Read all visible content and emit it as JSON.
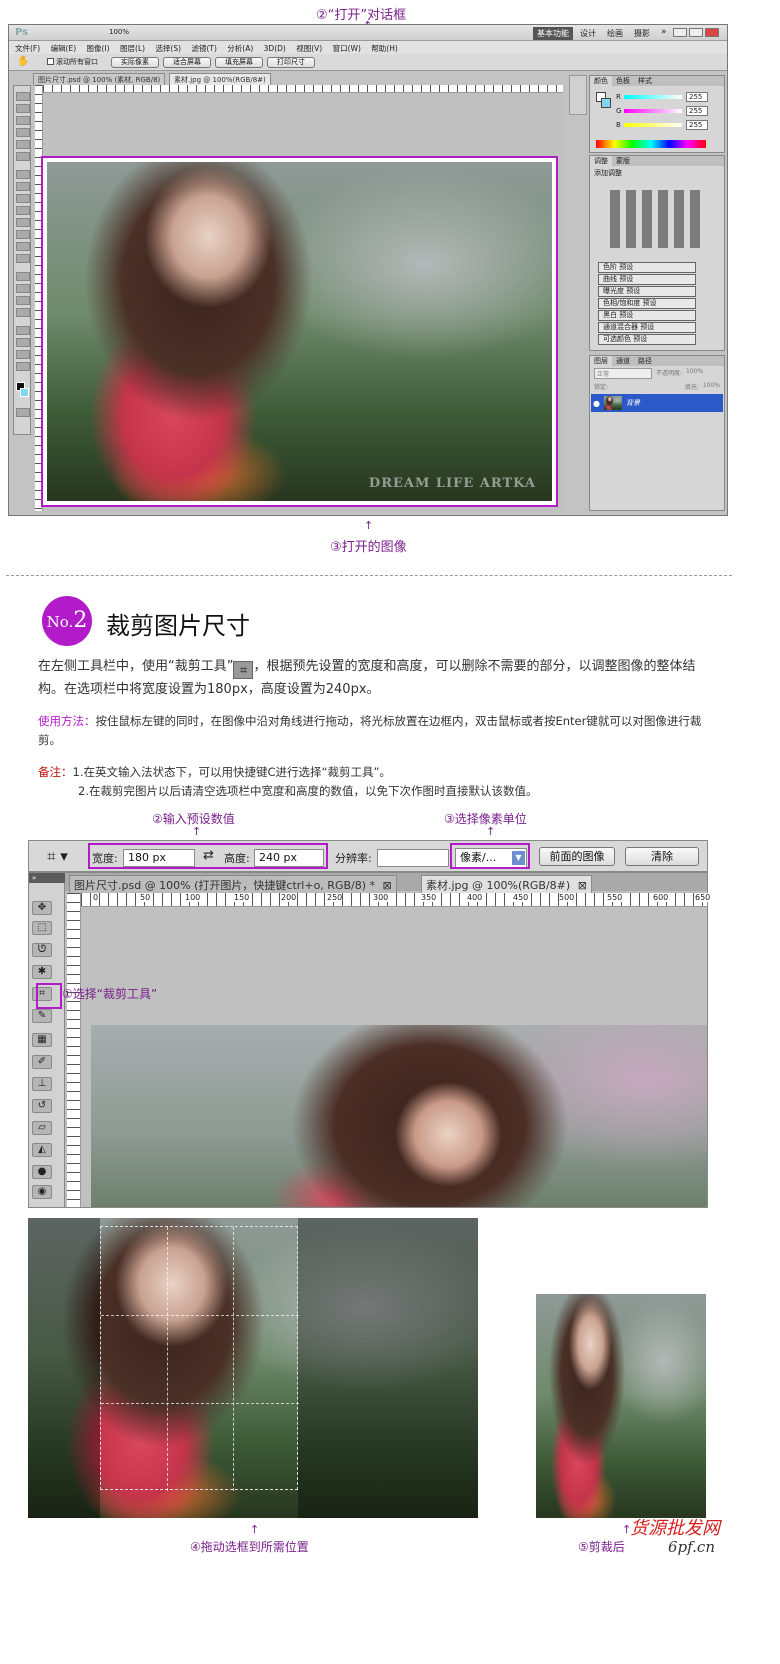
{
  "captions": {
    "open_dialog": "②“打开”对话框",
    "opened_image": "③打开的图像",
    "input_values": "②输入预设数值",
    "select_unit": "③选择像素单位",
    "select_crop_tool": "①选择“裁剪工具”",
    "drag_box": "④拖动选框到所需位置",
    "after_crop": "⑤剪裁后"
  },
  "ps_top": {
    "logo": "Ps",
    "zoom": "100%",
    "workspace_buttons": [
      "基本功能",
      "设计",
      "绘画",
      "摄影"
    ],
    "more": "»",
    "menu": [
      "文件(F)",
      "编辑(E)",
      "图像(I)",
      "图层(L)",
      "选择(S)",
      "滤镜(T)",
      "分析(A)",
      "3D(D)",
      "视图(V)",
      "窗口(W)",
      "帮助(H)"
    ],
    "options": {
      "scroll_all": "滚动所有窗口",
      "buttons": [
        "实际像素",
        "适合屏幕",
        "填充屏幕",
        "打印尺寸"
      ]
    },
    "tabs": [
      "图片尺寸.psd @ 100% (素材, RGB/8)",
      "素材.jpg @ 100%(RGB/8#)"
    ],
    "color_panel": {
      "tabs": [
        "颜色",
        "色板",
        "样式"
      ],
      "channels": [
        {
          "label": "R",
          "value": "255"
        },
        {
          "label": "G",
          "value": "255"
        },
        {
          "label": "B",
          "value": "255"
        }
      ]
    },
    "adjust_panel": {
      "tabs": [
        "调整",
        "蒙版"
      ],
      "title": "添加调整",
      "presets": [
        "色阶 预设",
        "曲线 预设",
        "曝光度 预设",
        "色相/饱和度 预设",
        "黑白 预设",
        "通道混合器 预设",
        "可选颜色 预设"
      ]
    },
    "layers_panel": {
      "tabs": [
        "图层",
        "通道",
        "路径"
      ],
      "blend_mode": "正常",
      "opacity_label": "不透明度:",
      "opacity": "100%",
      "lock_label": "锁定:",
      "fill_label": "填充:",
      "fill": "100%",
      "layer_name": "背景"
    }
  },
  "section": {
    "badge_prefix": "No.",
    "badge_number": "2",
    "title": "裁剪图片尺寸",
    "intro_before": "在左侧工具栏中，使用“裁剪工具”",
    "intro_after": "，根据预先设置的宽度和高度，可以删除不需要的部分，以调整图像的整体结构。在选项栏中将宽度设置为180px，高度设置为240px。",
    "usage_label": "使用方法：",
    "usage_text": "按住鼠标左键的同时，在图像中沿对角线进行拖动，将光标放置在边框内，双击鼠标或者按Enter键就可以对图像进行裁剪。",
    "note_label": "备注：",
    "note_1": "1.在英文输入法状态下，可以用快捷键C进行选择“裁剪工具”。",
    "note_2": "2.在裁剪完图片以后请清空选项栏中宽度和高度的数值，以免下次作图时直接默认该数值。"
  },
  "crop_options": {
    "width_label": "宽度:",
    "width_value": "180 px",
    "swap_icon": "⇄",
    "height_label": "高度:",
    "height_value": "240 px",
    "resolution_label": "分辨率:",
    "resolution_value": "",
    "unit": "像素/...",
    "front_image": "前面的图像",
    "clear": "清除"
  },
  "ps_bottom": {
    "tabs": [
      "图片尺寸.psd @ 100% (打开图片，快捷键ctrl+o, RGB/8) *",
      "素材.jpg @ 100%(RGB/8#)"
    ],
    "ruler_labels": [
      "0",
      "50",
      "100",
      "150",
      "200",
      "250",
      "300",
      "350",
      "400",
      "450",
      "500",
      "550",
      "600",
      "650"
    ]
  },
  "watermark": {
    "site": "货源批发网",
    "url": "6pf.cn"
  },
  "photo_credit": "DREAM LIFE ARTKA"
}
